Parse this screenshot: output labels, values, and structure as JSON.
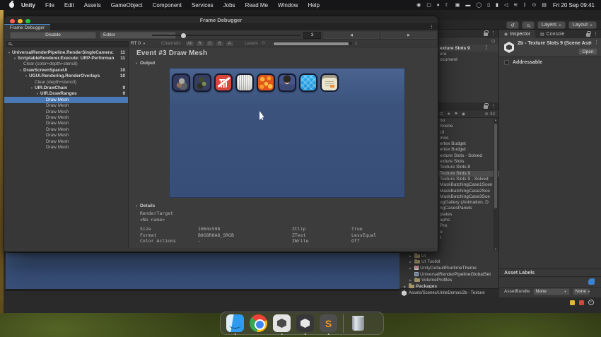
{
  "ui": {
    "caret_down": "▼",
    "caret_up": "▲",
    "caret_left": "◀",
    "caret_right": "▶",
    "collapsed": "▶",
    "kebab": "⋮",
    "check": "✓"
  },
  "menubar": {
    "items": [
      {
        "label": "Unity",
        "bold": true
      },
      {
        "label": "File"
      },
      {
        "label": "Edit"
      },
      {
        "label": "Assets"
      },
      {
        "label": "GameObject"
      },
      {
        "label": "Component"
      },
      {
        "label": "Services"
      },
      {
        "label": "Jobs"
      },
      {
        "label": "Read Me"
      },
      {
        "label": "Window"
      },
      {
        "label": "Help"
      }
    ],
    "status_icons": [
      {
        "name": "camera-icon",
        "glyph": "◉"
      },
      {
        "name": "display-icon",
        "glyph": "▢"
      },
      {
        "name": "tools-icon",
        "glyph": "♦"
      },
      {
        "name": "moon-icon",
        "glyph": "☾"
      },
      {
        "name": "app-v-icon",
        "glyph": "▣"
      },
      {
        "name": "keyboard-icon",
        "glyph": "▬"
      },
      {
        "name": "globe-icon",
        "glyph": "◯"
      },
      {
        "name": "battery-app-icon",
        "glyph": "▯"
      },
      {
        "name": "battery-icon",
        "glyph": "▮"
      },
      {
        "name": "volume-icon",
        "glyph": "◁"
      },
      {
        "name": "wifi-icon",
        "glyph": "≋"
      },
      {
        "name": "bluetooth-icon",
        "glyph": "ᛒ"
      },
      {
        "name": "search-icon",
        "glyph": "⊙"
      },
      {
        "name": "user-switch-icon",
        "glyph": "▤"
      }
    ],
    "clock": "Fri 20 Sep 09:41"
  },
  "frame_debugger": {
    "window_title": "Frame Debugger",
    "tab_label": "Frame Debugger",
    "toolbar": {
      "disable_label": "Disable",
      "target_label": "Editor",
      "event_value": "3"
    },
    "rt_row": {
      "rt_label": "RT 0",
      "channels_label": "Channels",
      "channels": [
        "All",
        "R",
        "G",
        "B",
        "A"
      ],
      "levels_label": "Levels",
      "levels_min": "0",
      "levels_max": "1"
    },
    "tree": [
      {
        "depth": 0,
        "arrow": true,
        "label": "UniversalRenderPipeline.RenderSingleCamera:",
        "count": "11"
      },
      {
        "depth": 1,
        "arrow": true,
        "label": "ScriptableRenderer.Execute: URP-Performan",
        "count": "11"
      },
      {
        "depth": 2,
        "arrow": false,
        "label": "Clear (color+depth+stencil)",
        "count": ""
      },
      {
        "depth": 2,
        "arrow": true,
        "label": "DrawScreenSpaceUI",
        "count": "10"
      },
      {
        "depth": 3,
        "arrow": true,
        "label": "UGUI.Rendering.RenderOverlays",
        "count": "10"
      },
      {
        "depth": 4,
        "arrow": false,
        "label": "Clear (depth+stencil)",
        "count": ""
      },
      {
        "depth": 4,
        "arrow": true,
        "label": "UIR.DrawChain",
        "count": "9"
      },
      {
        "depth": 5,
        "arrow": true,
        "label": "UIR.DrawRanges",
        "count": "9"
      },
      {
        "depth": 6,
        "arrow": false,
        "label": "Draw Mesh",
        "count": "",
        "selected": true
      },
      {
        "depth": 6,
        "arrow": false,
        "label": "Draw Mesh",
        "count": ""
      },
      {
        "depth": 6,
        "arrow": false,
        "label": "Draw Mesh",
        "count": ""
      },
      {
        "depth": 6,
        "arrow": false,
        "label": "Draw Mesh",
        "count": ""
      },
      {
        "depth": 6,
        "arrow": false,
        "label": "Draw Mesh",
        "count": ""
      },
      {
        "depth": 6,
        "arrow": false,
        "label": "Draw Mesh",
        "count": ""
      },
      {
        "depth": 6,
        "arrow": false,
        "label": "Draw Mesh",
        "count": ""
      },
      {
        "depth": 6,
        "arrow": false,
        "label": "Draw Mesh",
        "count": ""
      },
      {
        "depth": 6,
        "arrow": false,
        "label": "Draw Mesh",
        "count": ""
      }
    ],
    "event_title": "Event #3 Draw Mesh",
    "output_label": "Output",
    "textures": [
      {
        "name": "creature-texture"
      },
      {
        "name": "character-texture"
      },
      {
        "name": "delete-icon-texture"
      },
      {
        "name": "concrete-texture"
      },
      {
        "name": "lava-texture"
      },
      {
        "name": "portrait-texture"
      },
      {
        "name": "blue-diamond-texture"
      },
      {
        "name": "card-ui-texture"
      }
    ],
    "details": {
      "label": "Details",
      "render_target": "RenderTarget",
      "no_name": "<No name>",
      "rows": [
        {
          "k": "Size",
          "v": "1064x598",
          "k2": "ZClip",
          "v2": "True"
        },
        {
          "k": "Format",
          "v": "B8G8R8A8_SRGB",
          "k2": "ZTest",
          "v2": "LessEqual"
        },
        {
          "k": "Color Actions",
          "v": "-",
          "k2": "ZWrite",
          "v2": "Off"
        }
      ]
    }
  },
  "unity": {
    "toolbar": {
      "layers_label": "Layers",
      "layout_label": "Layout",
      "history_glyph": "↺"
    },
    "hierarchy": {
      "scene_label": "exture Slots 9",
      "children": [
        "era",
        "ocument"
      ]
    },
    "project": {
      "hidden_count": "33",
      "toolbar_icons": [
        {
          "name": "search-by-type-icon",
          "glyph": "⊡"
        },
        {
          "name": "favorites-icon",
          "glyph": "★"
        },
        {
          "name": "label-icon",
          "glyph": "⚑"
        },
        {
          "name": "info-icon",
          "glyph": "◉"
        }
      ],
      "items": [
        "nu",
        "Scene",
        "UI",
        "mos",
        "ertex Budget",
        "ertex Budget",
        "exture Slots - Solved",
        "exture Slots",
        "Texture Slots 8",
        "Texture Slots 9",
        "Texture Slots 9 - Solved",
        "MaskBatchingCase1Scen",
        "MaskBatchingCase2Sce",
        "MaskBatchingCase3Sce",
        "ogGallery (Animation, D",
        "ngCasesPanels",
        "plates",
        "aphs",
        "Pro",
        "o",
        "t"
      ],
      "selected_item": "Texture Slots 9",
      "tree": [
        {
          "label": "UI",
          "icon": "folder",
          "arrow": true
        },
        {
          "label": "UI Toolkit",
          "icon": "folder",
          "arrow": true
        },
        {
          "label": "UnityDefaultRuntimeTheme",
          "icon": "theme",
          "arrow": true
        },
        {
          "label": "UniversalRenderPipelineGlobalSet",
          "icon": "asset",
          "arrow": false
        },
        {
          "label": "VolumeProfiles",
          "icon": "folder",
          "arrow": true
        },
        {
          "label": "Packages",
          "icon": "folder",
          "arrow": true,
          "root": true
        }
      ],
      "path": "Assets/Scenes/UniteDemos/2b - Texture"
    },
    "inspector": {
      "tab_inspector": "Inspector",
      "tab_console": "Console",
      "title": "2b - Texture Slots 9 (Scene Ass",
      "open_label": "Open",
      "addressable_label": "Addressable",
      "asset_labels_header": "Asset Labels",
      "assetbundle_label": "AssetBundle",
      "bundle_value": "None",
      "variant_value": "None"
    },
    "colors": {
      "accent_blue": "#4a8fd4",
      "selection_blue": "#4a7ab5",
      "canvas_blue": "#3a527c"
    }
  },
  "dock": {
    "items": [
      {
        "name": "finder-dock-icon",
        "running": true
      },
      {
        "name": "chrome-dock-icon",
        "running": false
      },
      {
        "name": "unity-hub-dock-icon",
        "running": true
      },
      {
        "name": "unity-editor-dock-icon",
        "running": true
      },
      {
        "name": "sublime-text-dock-icon",
        "running": true
      },
      {
        "name": "trash-dock-icon",
        "running": false
      }
    ],
    "sublime_letter": "S"
  }
}
